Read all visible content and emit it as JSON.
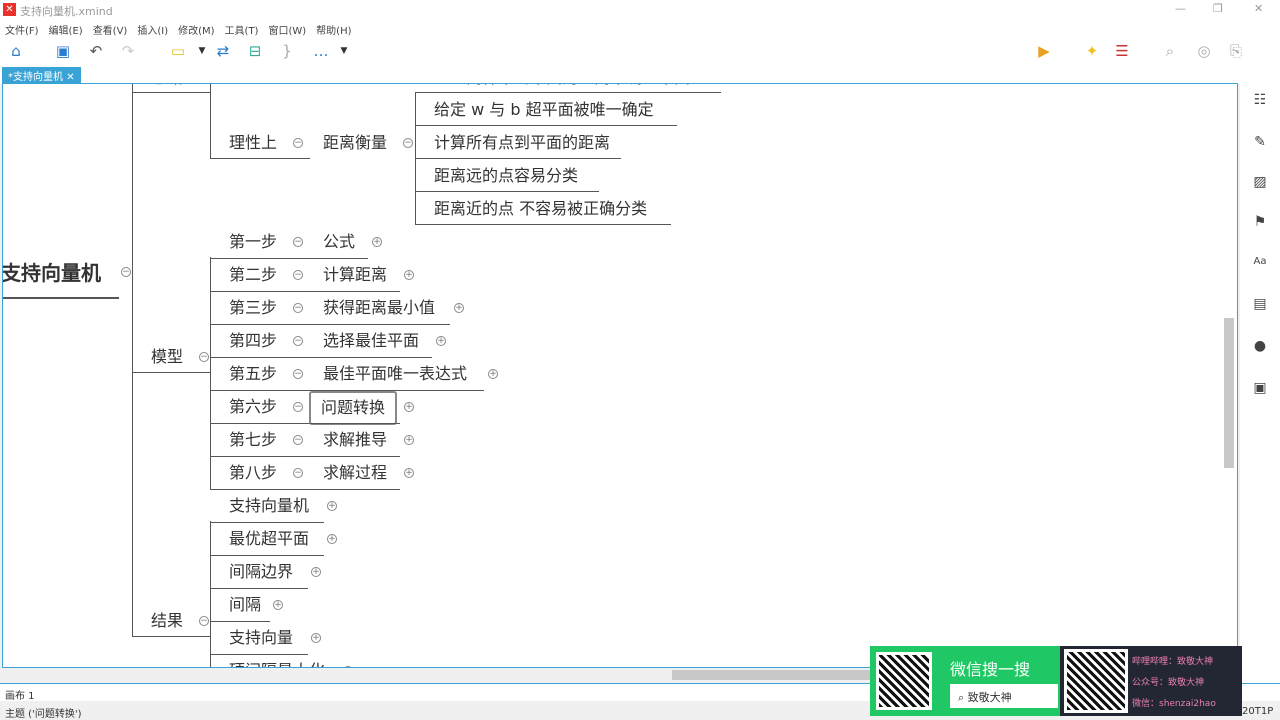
{
  "window": {
    "title": "支持向量机.xmind",
    "controls": [
      "—",
      "❐",
      "✕"
    ]
  },
  "menu": [
    "文件(F)",
    "编辑(E)",
    "查看(V)",
    "插入(I)",
    "修改(M)",
    "工具(T)",
    "窗口(W)",
    "帮助(H)"
  ],
  "tab": {
    "label": "*支持向量机",
    "close": "✕"
  },
  "map": {
    "root": "支持向量机",
    "branches": {
      "top": "思路",
      "model": "模型",
      "result": "结果"
    },
    "reason": {
      "label": "理性上",
      "child": "距离衡量",
      "top_clipped": "C距离样本到平面的距离来调整平面",
      "items": [
        "给定 w 与 b 超平面被唯一确定",
        "计算所有点到平面的距离",
        "距离远的点容易分类",
        "距离近的点 不容易被正确分类"
      ]
    },
    "steps": [
      {
        "step": "第一步",
        "topic": "公式"
      },
      {
        "step": "第二步",
        "topic": "计算距离"
      },
      {
        "step": "第三步",
        "topic": "获得距离最小值"
      },
      {
        "step": "第四步",
        "topic": "选择最佳平面"
      },
      {
        "step": "第五步",
        "topic": "最佳平面唯一表达式"
      },
      {
        "step": "第六步",
        "topic": "问题转换"
      },
      {
        "step": "第七步",
        "topic": "求解推导"
      },
      {
        "step": "第八步",
        "topic": "求解过程"
      }
    ],
    "selected_step": 5,
    "results": [
      "支持向量机",
      "最优超平面",
      "间隔边界",
      "间隔",
      "支持向量",
      "硬间隔最大化"
    ]
  },
  "sheet": {
    "label": "画布 1"
  },
  "status": {
    "text": "主题 ('问题转换')",
    "right": "20T1P"
  },
  "ad": {
    "search_title": "微信搜一搜",
    "search_text": "致敬大神",
    "lines": [
      "哔哩哔哩：致敬大神",
      "公众号：致敬大神",
      "微信：shenzai2hao"
    ]
  }
}
